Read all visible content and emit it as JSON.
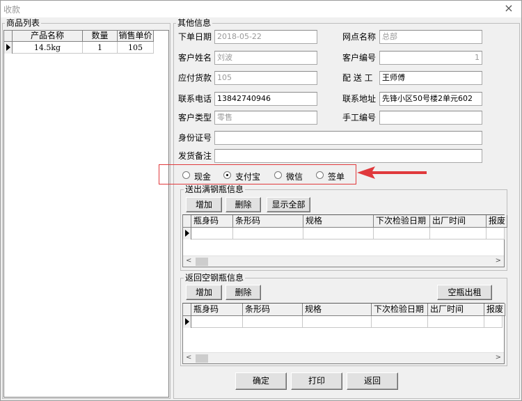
{
  "window": {
    "title": "收款",
    "close_glyph": "×"
  },
  "product_list": {
    "title": "商品列表",
    "columns": [
      "产品名称",
      "数量",
      "销售单价"
    ],
    "rows": [
      [
        "14.5kg",
        "1",
        "105"
      ]
    ]
  },
  "other_info": {
    "title": "其他信息",
    "fields": {
      "order_date": {
        "label": "下单日期",
        "value": "2018-05-22"
      },
      "outlet_name": {
        "label": "网点名称",
        "value": "总部"
      },
      "customer_name": {
        "label": "客户姓名",
        "value": "刘波"
      },
      "customer_no": {
        "label": "客户编号",
        "value": "1"
      },
      "amount_due": {
        "label": "应付货款",
        "value": "105"
      },
      "delivery_worker": {
        "label": "配 送 工",
        "value": "王师傅"
      },
      "phone": {
        "label": "联系电话",
        "value": "13842740946"
      },
      "address": {
        "label": "联系地址",
        "value": "先锋小区50号楼2单元602"
      },
      "customer_type": {
        "label": "客户类型",
        "value": "零售"
      },
      "manual_no": {
        "label": "手工编号",
        "value": ""
      },
      "id_card": {
        "label": "身份证号",
        "value": ""
      },
      "ship_note": {
        "label": "发货备注",
        "value": ""
      }
    }
  },
  "payment": {
    "options": [
      {
        "label": "现金",
        "selected": false
      },
      {
        "label": "支付宝",
        "selected": true
      },
      {
        "label": "微信",
        "selected": false
      },
      {
        "label": "签单",
        "selected": false
      }
    ],
    "highlight_color": "#e0393c"
  },
  "full_cylinders": {
    "title": "送出满钢瓶信息",
    "buttons": {
      "add": "增加",
      "delete": "删除",
      "show_all": "显示全部"
    },
    "columns": [
      "瓶身码",
      "条形码",
      "规格",
      "下次检验日期",
      "出厂时间",
      "报废"
    ]
  },
  "empty_cylinders": {
    "title": "返回空钢瓶信息",
    "buttons": {
      "add": "增加",
      "delete": "删除",
      "rent_out": "空瓶出租"
    },
    "columns": [
      "瓶身码",
      "条形码",
      "规格",
      "下次检验日期",
      "出厂时间",
      "报废"
    ]
  },
  "actions": {
    "ok": "确定",
    "print": "打印",
    "back": "返回"
  }
}
